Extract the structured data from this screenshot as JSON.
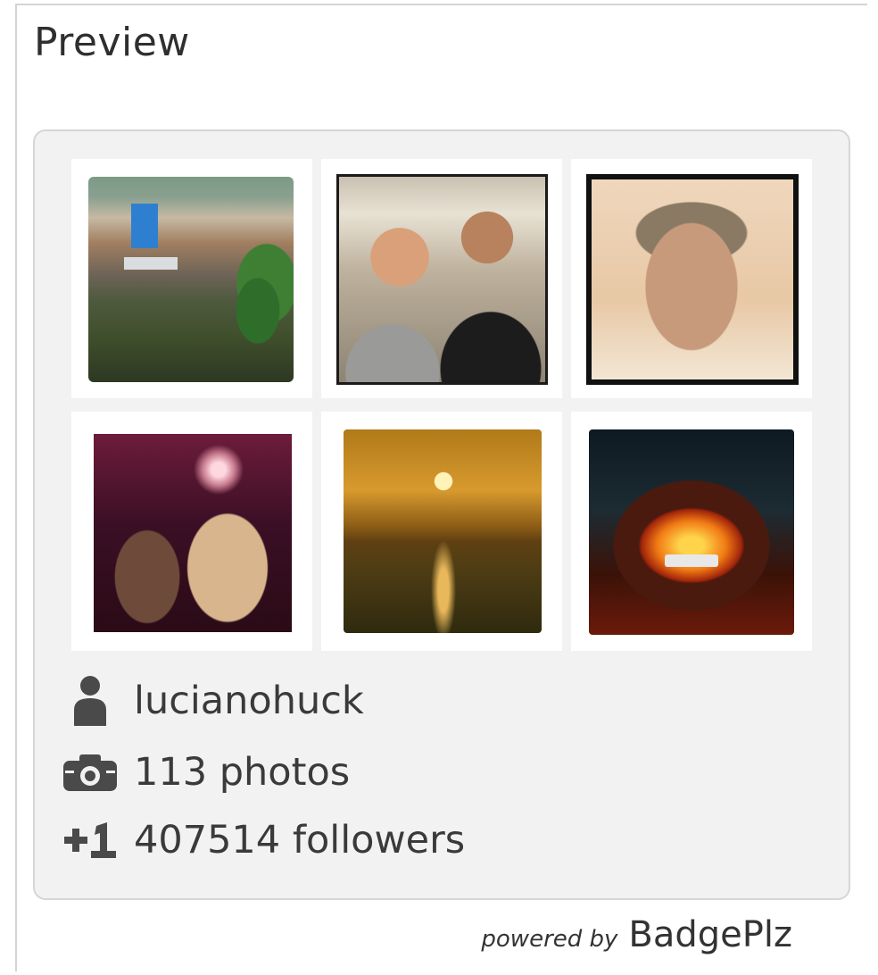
{
  "preview": {
    "title": "Preview"
  },
  "badge": {
    "photos": [
      {
        "icon": "photo-hillside-village"
      },
      {
        "icon": "photo-two-men-smiling"
      },
      {
        "icon": "photo-selfie-man"
      },
      {
        "icon": "photo-fireworks-couple"
      },
      {
        "icon": "photo-sunset-sea"
      },
      {
        "icon": "photo-pizza-oven"
      }
    ],
    "username": "lucianohuck",
    "photos_count": "113 photos",
    "followers_count": "407514 followers",
    "icons": {
      "user": "user-icon",
      "camera": "camera-icon",
      "plus_one": "plus-one-icon"
    }
  },
  "footer": {
    "powered_by": "powered by",
    "brand": "BadgePlz"
  },
  "colors": {
    "badge_bg": "#f2f2f2",
    "text": "#3a3a3a",
    "border": "#d6d6d6"
  }
}
